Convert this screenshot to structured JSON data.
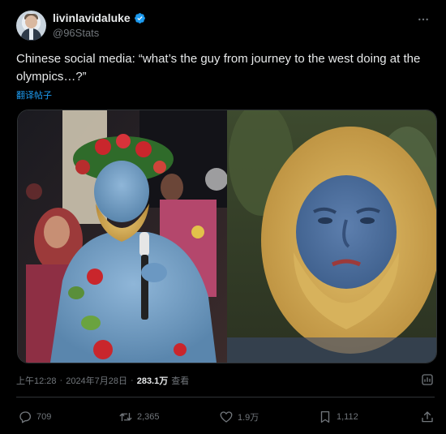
{
  "author": {
    "display_name": "livinlavidaluke",
    "handle": "@96Stats",
    "avatar_icon": "avatar-photo",
    "verified_icon": "verified-badge-icon",
    "verified_color": "#1d9bf0"
  },
  "tweet": {
    "text": "Chinese social media: “what’s the guy from journey to the west doing at the olympics…?”",
    "translate_label": "翻译帖子",
    "image_alt_icon": "photo-collage"
  },
  "meta": {
    "time": "上午12:28",
    "sep1": "·",
    "date": "2024年7月28日",
    "sep2": "·",
    "views_count": "283.1万",
    "views_label": "查看"
  },
  "actions": {
    "reply_count": "709",
    "retweet_count": "2,365",
    "like_count": "1.9万",
    "bookmark_count": "1,112"
  },
  "colors": {
    "background": "#000000",
    "text": "#e7e9ea",
    "muted": "#71767b",
    "accent": "#1d9bf0"
  }
}
